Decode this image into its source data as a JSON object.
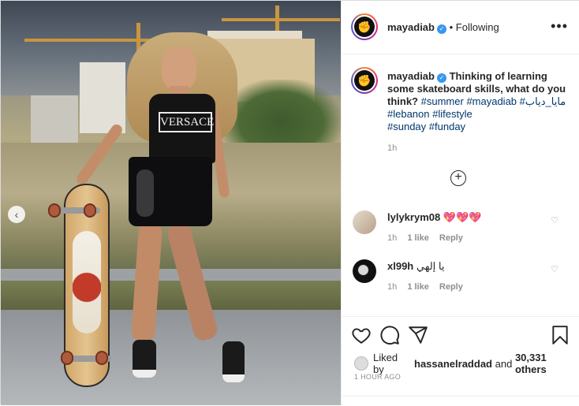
{
  "post": {
    "username": "mayadiab",
    "following_label": "Following",
    "more_label": "•••",
    "caption": {
      "username": "mayadiab",
      "text": "Thinking of learning some skateboard skills, what do you think?",
      "hashtags": [
        "#summer",
        "#mayadiab",
        "#مايا_دياب",
        "#lebanon",
        "#lifestyle",
        "#sunday",
        "#funday"
      ]
    },
    "caption_time": "1h",
    "load_more_label": "+"
  },
  "photo": {
    "shirt_text": "VERSACE",
    "prev_label": "‹"
  },
  "comments": [
    {
      "username": "lylykrym08",
      "text": "💖💖💖",
      "time": "1h",
      "likes": "1 like",
      "reply": "Reply"
    },
    {
      "username": "xl99h",
      "text": "يا إلهي",
      "time": "1h",
      "likes": "1 like",
      "reply": "Reply"
    }
  ],
  "actions": {
    "liked_by_prefix": "Liked by",
    "liked_by_user": "hassanelraddad",
    "liked_by_and": "and",
    "liked_by_count": "30,331 others",
    "time_ago": "1 HOUR AGO"
  },
  "colors": {
    "accent_link": "#00376b",
    "verified": "#3897f0",
    "meta_gray": "#8e8e8e"
  },
  "icons": [
    "more-icon",
    "verified-icon",
    "heart-icon",
    "comment-icon",
    "share-icon",
    "bookmark-icon",
    "plus-circle-icon",
    "chevron-left-icon"
  ]
}
